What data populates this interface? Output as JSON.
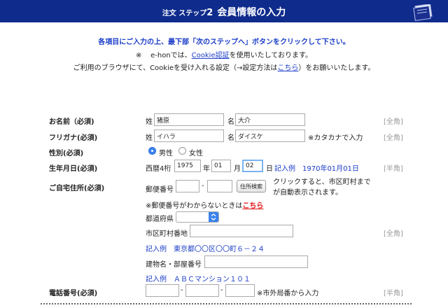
{
  "header": {
    "step_prefix": "注文 ステップ",
    "step_num": "2",
    "title": "会員情報の入力"
  },
  "intro": {
    "line1": "各項目にご入力の上、最下部「次のステップへ」ボタンをクリックして下さい。",
    "line2_mark": "※",
    "line2_pre": "e-honでは、",
    "line2_link": "Cookie認証",
    "line2_post": "を使用いたしております。",
    "line3_pre": "ご利用のブラウザにて、Cookieを受け入れる設定（→設定方法は",
    "line3_link": "こちら",
    "line3_post": "）をお願いいたします。"
  },
  "name": {
    "label": "お名前（必須)",
    "sei_label": "姓",
    "sei_value": "猪原",
    "mei_label": "名",
    "mei_value": "大介",
    "note": "[全角]"
  },
  "kana": {
    "label": "フリガナ(必須)",
    "sei_label": "姓",
    "sei_value": "イハラ",
    "mei_label": "名",
    "mei_value": "ダイスケ",
    "hint": "※カタカナで入力",
    "note": "[全角]"
  },
  "gender": {
    "label": "性別(必須)",
    "male": "男性",
    "female": "女性",
    "selected": "male"
  },
  "birthday": {
    "label": "生年月日(必須)",
    "era_label": "西暦4桁",
    "year": "1975",
    "year_unit": "年",
    "month": "01",
    "month_unit": "月",
    "day": "02",
    "day_unit": "日",
    "example": "記入例　1970年01月01日",
    "note": "[半角]"
  },
  "address": {
    "label": "ご自宅住所(必須)",
    "postal_label": "郵便番号",
    "postal_dash": "-",
    "postal_1": "",
    "postal_2": "",
    "search_button": "住所検索",
    "search_hint_1": "クリックすると、市区町村まで",
    "search_hint_2": "が自動表示されます。",
    "unknown_pre": "※郵便番号がわからないときは",
    "unknown_link": "こちら",
    "pref_label": "都道府県",
    "pref_value": "",
    "city_label": "市区町村番地",
    "city_value": "",
    "city_note": "[全角]",
    "city_example": "記入例　東京都〇〇区〇〇町６－２４",
    "building_label": "建物名・部屋番号",
    "building_value": "",
    "building_example": "記入例　ＡＢＣマンション１０１"
  },
  "phone": {
    "label": "電話番号(必須)",
    "dash": "-",
    "part1": "",
    "part2": "",
    "part3": "",
    "hint": "※市外局番から入力",
    "note": "[半角]"
  }
}
